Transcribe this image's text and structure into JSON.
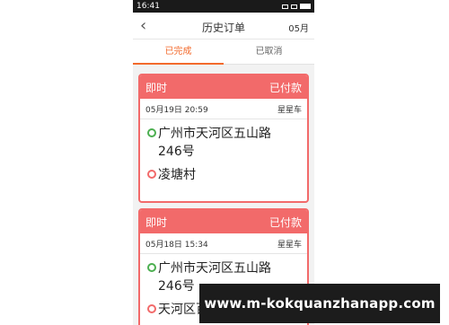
{
  "status_bar": {
    "time": "16:41"
  },
  "header": {
    "back_icon": "chevron-left-icon",
    "title": "历史订单",
    "month": "05月"
  },
  "tabs": [
    {
      "label": "已完成",
      "active": true
    },
    {
      "label": "已取消",
      "active": false
    }
  ],
  "orders": [
    {
      "type": "即时",
      "status": "已付款",
      "datetime": "05月19日 20:59",
      "vehicle": "星星车",
      "from_line1": "广州市天河区五山路",
      "from_line2": "246号",
      "to": "凌塘村"
    },
    {
      "type": "即时",
      "status": "已付款",
      "datetime": "05月18日 15:34",
      "vehicle": "星星车",
      "from_line1": "广州市天河区五山路",
      "from_line2": "246号",
      "to": "天河区百脑汇电脑城(天"
    }
  ],
  "watermark": "www.m-kokquanzhanapp.com",
  "colors": {
    "accent": "#f36a2c",
    "card": "#f26a6a",
    "origin_pin": "#4caf50"
  }
}
